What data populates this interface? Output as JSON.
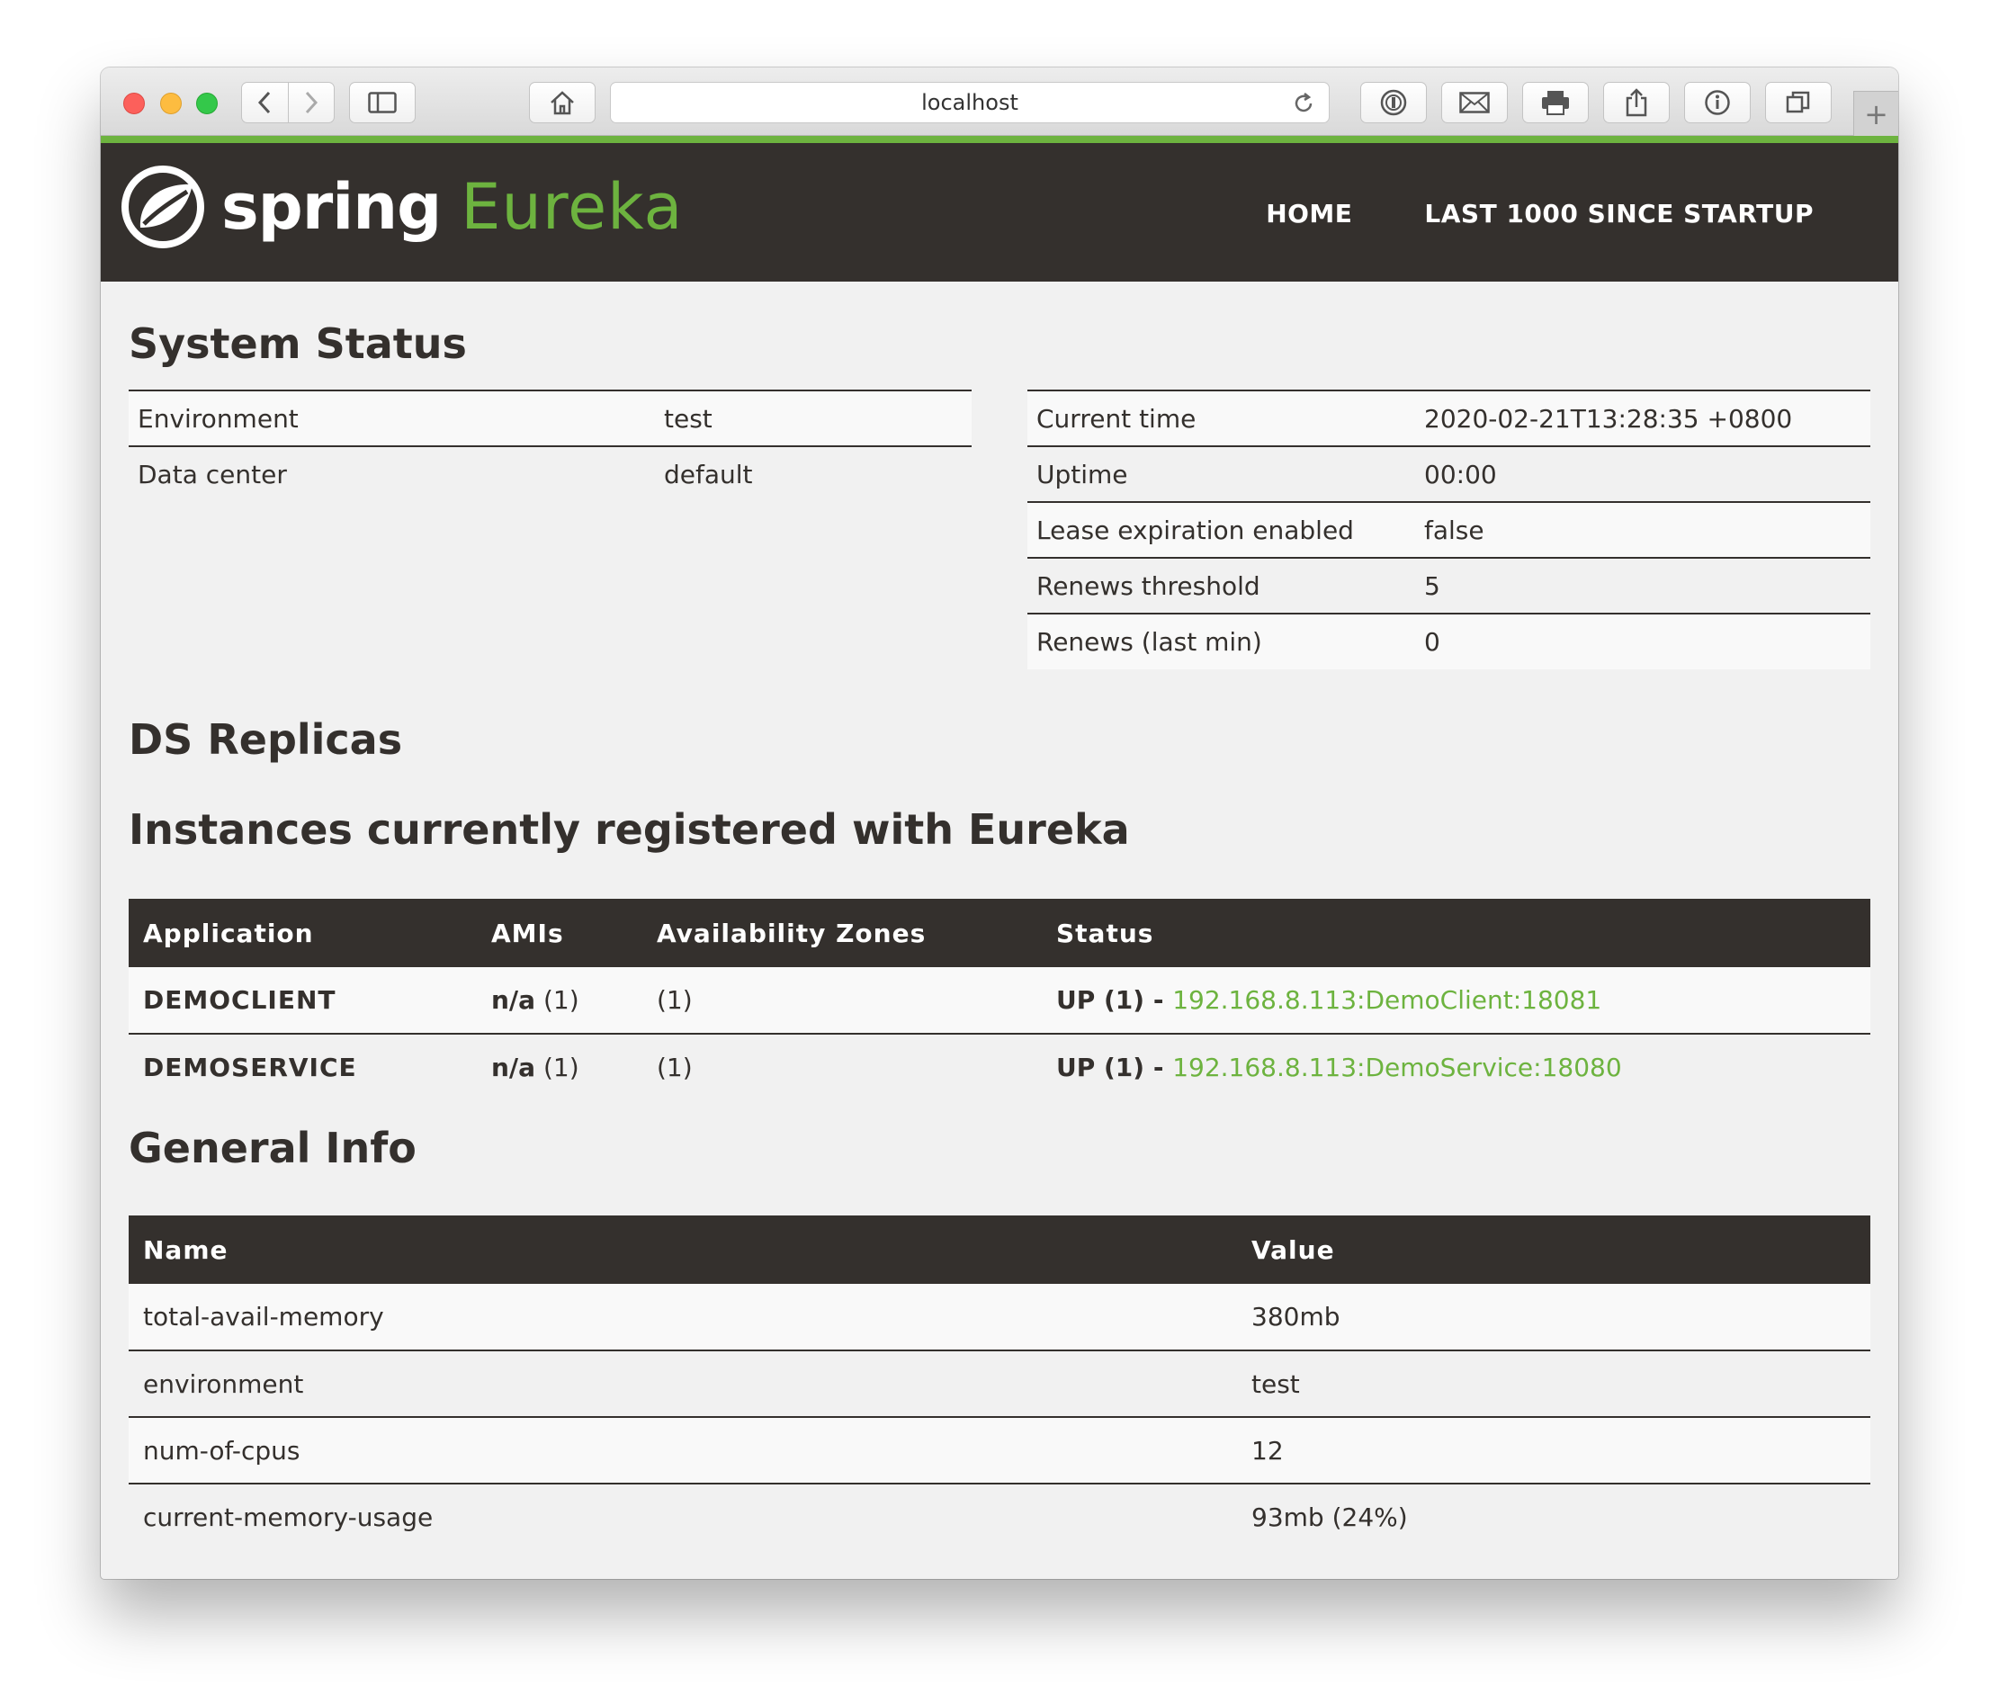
{
  "browser": {
    "url": "localhost",
    "new_tab_label": "+"
  },
  "nav": {
    "brand_spring": "spring",
    "brand_eureka": "Eureka",
    "home": "HOME",
    "last1000": "LAST 1000 SINCE STARTUP"
  },
  "system_status": {
    "title": "System Status",
    "left": [
      {
        "label": "Environment",
        "value": "test"
      },
      {
        "label": "Data center",
        "value": "default"
      }
    ],
    "right": [
      {
        "label": "Current time",
        "value": "2020-02-21T13:28:35 +0800"
      },
      {
        "label": "Uptime",
        "value": "00:00"
      },
      {
        "label": "Lease expiration enabled",
        "value": "false"
      },
      {
        "label": "Renews threshold",
        "value": "5"
      },
      {
        "label": "Renews (last min)",
        "value": "0"
      }
    ]
  },
  "ds_replicas": {
    "title": "DS Replicas"
  },
  "instances": {
    "title": "Instances currently registered with Eureka",
    "headers": [
      "Application",
      "AMIs",
      "Availability Zones",
      "Status"
    ],
    "rows": [
      {
        "app": "DEMOCLIENT",
        "ami_name": "n/a",
        "ami_count": " (1)",
        "zones": "(1)",
        "status_prefix": "UP (1) - ",
        "link": "192.168.8.113:DemoClient:18081"
      },
      {
        "app": "DEMOSERVICE",
        "ami_name": "n/a",
        "ami_count": " (1)",
        "zones": "(1)",
        "status_prefix": "UP (1) - ",
        "link": "192.168.8.113:DemoService:18080"
      }
    ]
  },
  "general_info": {
    "title": "General Info",
    "headers": [
      "Name",
      "Value"
    ],
    "rows": [
      {
        "name": "total-avail-memory",
        "value": "380mb"
      },
      {
        "name": "environment",
        "value": "test"
      },
      {
        "name": "num-of-cpus",
        "value": "12"
      },
      {
        "name": "current-memory-usage",
        "value": "93mb (24%)"
      }
    ]
  },
  "colors": {
    "brand_green": "#6db33f",
    "dark": "#34302d",
    "page_bg": "#f1f1f1"
  }
}
